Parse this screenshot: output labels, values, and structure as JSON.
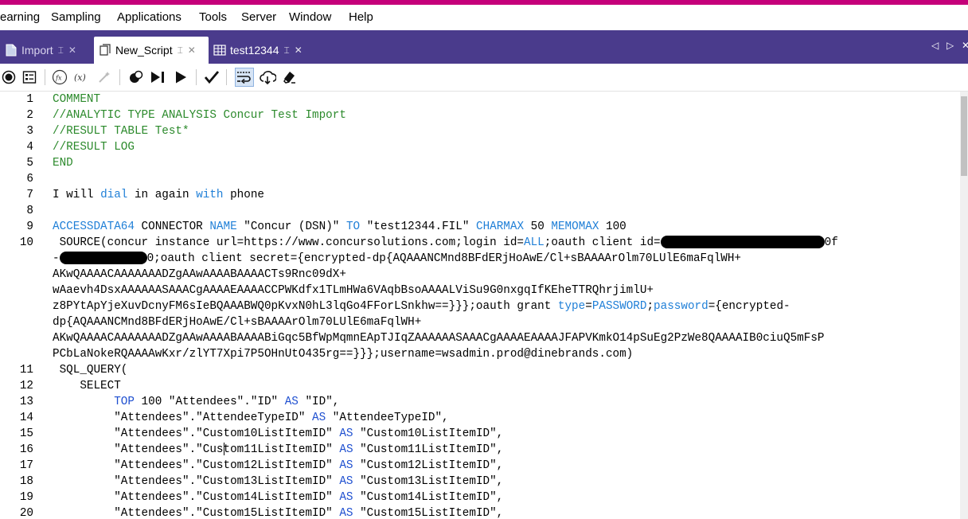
{
  "menubar": {
    "items": [
      "earning",
      "Sampling",
      "Applications",
      "Tools",
      "Server",
      "Window",
      "Help"
    ]
  },
  "tabs": [
    {
      "label": "Import",
      "icon": "document-icon",
      "active": false
    },
    {
      "label": "New_Script",
      "icon": "script-icon",
      "active": true
    },
    {
      "label": "test12344",
      "icon": "table-icon",
      "active": false
    }
  ],
  "toolbar": {
    "icons": [
      "record-icon",
      "properties-icon",
      "function-icon",
      "variable-icon",
      "magic-wand-icon",
      "breakpoint-icon",
      "step-run-icon",
      "run-icon",
      "check-icon",
      "word-wrap-icon",
      "cloud-sync-icon",
      "eraser-icon"
    ]
  },
  "editor": {
    "lines": [
      {
        "n": "1",
        "segs": [
          {
            "t": "COMMENT",
            "c": "comment"
          }
        ]
      },
      {
        "n": "2",
        "segs": [
          {
            "t": "//ANALYTIC TYPE ANALYSIS Concur Test Import",
            "c": "comment"
          }
        ]
      },
      {
        "n": "3",
        "segs": [
          {
            "t": "//RESULT TABLE Test*",
            "c": "comment"
          }
        ]
      },
      {
        "n": "4",
        "segs": [
          {
            "t": "//RESULT LOG",
            "c": "comment"
          }
        ]
      },
      {
        "n": "5",
        "segs": [
          {
            "t": "END",
            "c": "comment"
          }
        ]
      },
      {
        "n": "6",
        "segs": []
      },
      {
        "n": "7",
        "segs": [
          {
            "t": "I will ",
            "c": ""
          },
          {
            "t": "dial",
            "c": "dkw"
          },
          {
            "t": " in again ",
            "c": ""
          },
          {
            "t": "with",
            "c": "dkw"
          },
          {
            "t": " phone",
            "c": ""
          }
        ]
      },
      {
        "n": "8",
        "segs": []
      },
      {
        "n": "9",
        "segs": [
          {
            "t": "ACCESSDATA64",
            "c": "dkw"
          },
          {
            "t": " CONNECTOR ",
            "c": ""
          },
          {
            "t": "NAME",
            "c": "dkw"
          },
          {
            "t": " \"Concur (DSN)\" ",
            "c": ""
          },
          {
            "t": "TO",
            "c": "dkw"
          },
          {
            "t": " \"test12344.FIL\" ",
            "c": ""
          },
          {
            "t": "CHARMAX",
            "c": "dkw"
          },
          {
            "t": " 50 ",
            "c": ""
          },
          {
            "t": "MEMOMAX",
            "c": "dkw"
          },
          {
            "t": " 100",
            "c": ""
          }
        ]
      },
      {
        "n": "10",
        "segs": [
          {
            "t": " SOURCE(concur instance url=https://www.concursolutions.com;login id=",
            "c": ""
          },
          {
            "t": "ALL",
            "c": "dkw"
          },
          {
            "t": ";oauth client id=",
            "c": ""
          },
          {
            "t": "",
            "c": "redact",
            "w": 206
          },
          {
            "t": "0f",
            "c": ""
          }
        ]
      },
      {
        "n": "",
        "segs": [
          {
            "t": "-",
            "c": ""
          },
          {
            "t": "",
            "c": "redact",
            "w": 110
          },
          {
            "t": "0;oauth client secret={encrypted-dp{AQAAANCMnd8BFdERjHoAwE/Cl+sBAAAArOlm70LUlE6maFqlWH+",
            "c": ""
          }
        ]
      },
      {
        "n": "",
        "segs": [
          {
            "t": "AKwQAAAACAAAAAAADZgAAwAAAABAAAACTs9Rnc09dX+",
            "c": ""
          }
        ]
      },
      {
        "n": "",
        "segs": [
          {
            "t": "wAaevh4DsxAAAAAASAAACgAAAAEAAAACCPWKdfx1TLmHWa6VAqbBsoAAAALViSu9G0nxgqIfKEheTTRQhrjimlU+",
            "c": ""
          }
        ]
      },
      {
        "n": "",
        "segs": [
          {
            "t": "z8PYtApYjeXuvDcnyFM6sIeBQAAABWQ0pKvxN0hL3lqGo4FForLSnkhw==}}};oauth grant ",
            "c": ""
          },
          {
            "t": "type",
            "c": "dkw"
          },
          {
            "t": "=",
            "c": ""
          },
          {
            "t": "PASSWORD",
            "c": "dkw"
          },
          {
            "t": ";",
            "c": ""
          },
          {
            "t": "password",
            "c": "dkw"
          },
          {
            "t": "={encrypted-",
            "c": ""
          }
        ]
      },
      {
        "n": "",
        "segs": [
          {
            "t": "dp{AQAAANCMnd8BFdERjHoAwE/Cl+sBAAAArOlm70LUlE6maFqlWH+",
            "c": ""
          }
        ]
      },
      {
        "n": "",
        "segs": [
          {
            "t": "AKwQAAAACAAAAAAADZgAAwAAAABAAAABiGqc5BfWpMqmnEApTJIqZAAAAAASAAACgAAAAEAAAAJFAPVKmkO14pSuEg2PzWe8QAAAAIB0ciuQ5mFsP",
            "c": ""
          }
        ]
      },
      {
        "n": "",
        "segs": [
          {
            "t": "PCbLaNokeRQAAAAwKxr/zlYT7Xpi7P5OHnUtO435rg==}}};username=wsadmin.prod@dinebrands.com)",
            "c": ""
          }
        ]
      },
      {
        "n": "11",
        "segs": [
          {
            "t": " SQL_QUERY(",
            "c": ""
          }
        ]
      },
      {
        "n": "12",
        "segs": [
          {
            "t": "    SELECT",
            "c": ""
          }
        ]
      },
      {
        "n": "13",
        "segs": [
          {
            "t": "         ",
            "c": ""
          },
          {
            "t": "TOP",
            "c": "kw"
          },
          {
            "t": " 100 \"Attendees\".\"ID\" ",
            "c": ""
          },
          {
            "t": "AS",
            "c": "kw"
          },
          {
            "t": " \"ID\",",
            "c": ""
          }
        ]
      },
      {
        "n": "14",
        "segs": [
          {
            "t": "         \"Attendees\".\"AttendeeTypeID\" ",
            "c": ""
          },
          {
            "t": "AS",
            "c": "kw"
          },
          {
            "t": " \"AttendeeTypeID\",",
            "c": ""
          }
        ]
      },
      {
        "n": "15",
        "segs": [
          {
            "t": "         \"Attendees\".\"Custom10ListItemID\" ",
            "c": ""
          },
          {
            "t": "AS",
            "c": "kw"
          },
          {
            "t": " \"Custom10ListItemID\",",
            "c": ""
          }
        ]
      },
      {
        "n": "16",
        "segs": [
          {
            "t": "         \"Attendees\".\"Cus",
            "c": ""
          },
          {
            "t": "",
            "c": "caret"
          },
          {
            "t": "tom11ListItemID\" ",
            "c": ""
          },
          {
            "t": "AS",
            "c": "kw"
          },
          {
            "t": " \"Custom11ListItemID\",",
            "c": ""
          }
        ]
      },
      {
        "n": "17",
        "segs": [
          {
            "t": "         \"Attendees\".\"Custom12ListItemID\" ",
            "c": ""
          },
          {
            "t": "AS",
            "c": "kw"
          },
          {
            "t": " \"Custom12ListItemID\",",
            "c": ""
          }
        ]
      },
      {
        "n": "18",
        "segs": [
          {
            "t": "         \"Attendees\".\"Custom13ListItemID\" ",
            "c": ""
          },
          {
            "t": "AS",
            "c": "kw"
          },
          {
            "t": " \"Custom13ListItemID\",",
            "c": ""
          }
        ]
      },
      {
        "n": "19",
        "segs": [
          {
            "t": "         \"Attendees\".\"Custom14ListItemID\" ",
            "c": ""
          },
          {
            "t": "AS",
            "c": "kw"
          },
          {
            "t": " \"Custom14ListItemID\",",
            "c": ""
          }
        ]
      },
      {
        "n": "20",
        "segs": [
          {
            "t": "         \"Attendees\".\"Custom15ListItemID\" ",
            "c": ""
          },
          {
            "t": "AS",
            "c": "kw"
          },
          {
            "t": " \"Custom15ListItemID\",",
            "c": ""
          }
        ]
      }
    ]
  },
  "colors": {
    "title_accent": "#c5007a",
    "tab_bar": "#4a3b8c",
    "comment": "#2c8a2c",
    "keyword": "#1e4fd0"
  }
}
